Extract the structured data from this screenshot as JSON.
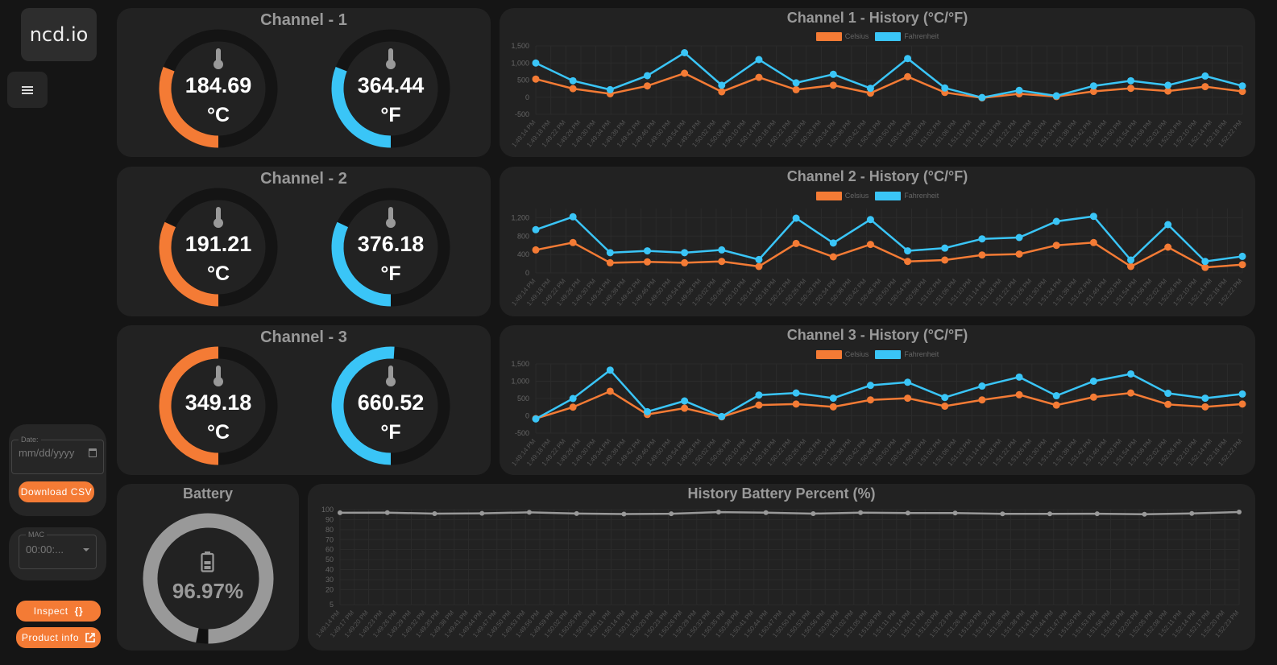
{
  "sidebar": {
    "logo": "ncd.io",
    "menu_icon": "hamburger-menu-icon",
    "date_legend": "Date:",
    "date_placeholder": "mm/dd/yyyy",
    "download_csv": "Download CSV",
    "mac_legend": "MAC",
    "mac_value": "00:00:...",
    "inspect": "Inspect",
    "inspect_icon": "{}",
    "product_info": "Product info"
  },
  "colors": {
    "celsius": "#f47b35",
    "fahrenheit": "#3ac5f7",
    "battery": "#999999",
    "bg": "#151515",
    "panel": "#222222"
  },
  "channels": [
    {
      "title": "Channel - 1",
      "celsius": "184.69",
      "celsius_unit": "°C",
      "fahrenheit": "364.44",
      "fahrenheit_unit": "°F",
      "celsius_fraction": 0.31,
      "fahrenheit_fraction": 0.31
    },
    {
      "title": "Channel - 2",
      "celsius": "191.21",
      "celsius_unit": "°C",
      "fahrenheit": "376.18",
      "fahrenheit_unit": "°F",
      "celsius_fraction": 0.32,
      "fahrenheit_fraction": 0.32
    },
    {
      "title": "Channel - 3",
      "celsius": "349.18",
      "celsius_unit": "°C",
      "fahrenheit": "660.52",
      "fahrenheit_unit": "°F",
      "celsius_fraction": 0.5,
      "fahrenheit_fraction": 0.51
    }
  ],
  "battery": {
    "title": "Battery",
    "value": "96.97%",
    "fraction": 0.9697
  },
  "chart_data": [
    {
      "type": "line",
      "title": "Channel 1 - History (°C/°F)",
      "legend": [
        "Celsius",
        "Fahrenheit"
      ],
      "legend_position": "top",
      "ylim": [
        -500,
        1500
      ],
      "yticks": [
        "1,500",
        "1,000",
        "500",
        "0",
        "-500"
      ],
      "ytick_values": [
        1500,
        1000,
        500,
        0,
        -500
      ],
      "x_labels": [
        "1:49:14 PM",
        "1:49:18 PM",
        "1:49:22 PM",
        "1:49:26 PM",
        "1:49:30 PM",
        "1:49:34 PM",
        "1:49:38 PM",
        "1:49:42 PM",
        "1:49:46 PM",
        "1:49:50 PM",
        "1:49:54 PM",
        "1:49:58 PM",
        "1:50:02 PM",
        "1:50:06 PM",
        "1:50:10 PM",
        "1:50:14 PM",
        "1:50:18 PM",
        "1:50:22 PM",
        "1:50:26 PM",
        "1:50:30 PM",
        "1:50:34 PM",
        "1:50:38 PM",
        "1:50:42 PM",
        "1:50:46 PM",
        "1:50:50 PM",
        "1:50:54 PM",
        "1:50:58 PM",
        "1:51:02 PM",
        "1:51:06 PM",
        "1:51:10 PM",
        "1:51:14 PM",
        "1:51:18 PM",
        "1:51:22 PM",
        "1:51:26 PM",
        "1:51:30 PM",
        "1:51:34 PM",
        "1:51:38 PM",
        "1:51:42 PM",
        "1:51:46 PM",
        "1:51:50 PM",
        "1:51:54 PM",
        "1:51:58 PM",
        "1:52:02 PM",
        "1:52:06 PM",
        "1:52:10 PM",
        "1:52:14 PM",
        "1:52:18 PM",
        "1:52:22 PM"
      ],
      "series": [
        {
          "name": "Celsius",
          "values": [
            530,
            250,
            100,
            330,
            700,
            160,
            580,
            220,
            350,
            120,
            600,
            140,
            -20,
            100,
            20,
            170,
            260,
            180,
            310,
            170
          ]
        },
        {
          "name": "Fahrenheit",
          "values": [
            1000,
            480,
            220,
            630,
            1300,
            350,
            1100,
            420,
            670,
            260,
            1130,
            270,
            -10,
            200,
            40,
            330,
            480,
            350,
            620,
            330
          ]
        }
      ]
    },
    {
      "type": "line",
      "title": "Channel 2 - History (°C/°F)",
      "legend": [
        "Celsius",
        "Fahrenheit"
      ],
      "legend_position": "top",
      "ylim": [
        0,
        1400
      ],
      "yticks": [
        "1,200",
        "800",
        "400",
        "0"
      ],
      "ytick_values": [
        1200,
        800,
        400,
        0
      ],
      "x_labels": [
        "1:49:14 PM",
        "1:49:18 PM",
        "1:49:22 PM",
        "1:49:26 PM",
        "1:49:30 PM",
        "1:49:34 PM",
        "1:49:38 PM",
        "1:49:42 PM",
        "1:49:46 PM",
        "1:49:50 PM",
        "1:49:54 PM",
        "1:49:58 PM",
        "1:50:02 PM",
        "1:50:06 PM",
        "1:50:10 PM",
        "1:50:14 PM",
        "1:50:18 PM",
        "1:50:22 PM",
        "1:50:26 PM",
        "1:50:30 PM",
        "1:50:34 PM",
        "1:50:38 PM",
        "1:50:42 PM",
        "1:50:46 PM",
        "1:50:50 PM",
        "1:50:54 PM",
        "1:50:58 PM",
        "1:51:02 PM",
        "1:51:06 PM",
        "1:51:10 PM",
        "1:51:14 PM",
        "1:51:18 PM",
        "1:51:22 PM",
        "1:51:26 PM",
        "1:51:30 PM",
        "1:51:34 PM",
        "1:51:38 PM",
        "1:51:42 PM",
        "1:51:46 PM",
        "1:51:50 PM",
        "1:51:54 PM",
        "1:51:58 PM",
        "1:52:02 PM",
        "1:52:06 PM",
        "1:52:10 PM",
        "1:52:14 PM",
        "1:52:18 PM",
        "1:52:22 PM"
      ],
      "series": [
        {
          "name": "Celsius",
          "values": [
            500,
            660,
            220,
            240,
            220,
            250,
            140,
            640,
            350,
            620,
            250,
            280,
            390,
            410,
            600,
            660,
            140,
            560,
            120,
            180
          ]
        },
        {
          "name": "Fahrenheit",
          "values": [
            940,
            1220,
            440,
            480,
            440,
            500,
            290,
            1190,
            650,
            1160,
            480,
            540,
            740,
            770,
            1120,
            1230,
            280,
            1050,
            250,
            360
          ]
        }
      ]
    },
    {
      "type": "line",
      "title": "Channel 3 - History (°C/°F)",
      "legend": [
        "Celsius",
        "Fahrenheit"
      ],
      "legend_position": "top",
      "ylim": [
        -500,
        1500
      ],
      "yticks": [
        "1,500",
        "1,000",
        "500",
        "0",
        "-500"
      ],
      "ytick_values": [
        1500,
        1000,
        500,
        0,
        -500
      ],
      "x_labels": [
        "1:49:14 PM",
        "1:49:18 PM",
        "1:49:22 PM",
        "1:49:26 PM",
        "1:49:30 PM",
        "1:49:34 PM",
        "1:49:38 PM",
        "1:49:42 PM",
        "1:49:46 PM",
        "1:49:50 PM",
        "1:49:54 PM",
        "1:49:58 PM",
        "1:50:02 PM",
        "1:50:06 PM",
        "1:50:10 PM",
        "1:50:14 PM",
        "1:50:18 PM",
        "1:50:22 PM",
        "1:50:26 PM",
        "1:50:30 PM",
        "1:50:34 PM",
        "1:50:38 PM",
        "1:50:42 PM",
        "1:50:46 PM",
        "1:50:50 PM",
        "1:50:54 PM",
        "1:50:58 PM",
        "1:51:02 PM",
        "1:51:06 PM",
        "1:51:10 PM",
        "1:51:14 PM",
        "1:51:18 PM",
        "1:51:22 PM",
        "1:51:26 PM",
        "1:51:30 PM",
        "1:51:34 PM",
        "1:51:38 PM",
        "1:51:42 PM",
        "1:51:46 PM",
        "1:51:50 PM",
        "1:51:54 PM",
        "1:51:58 PM",
        "1:52:02 PM",
        "1:52:06 PM",
        "1:52:10 PM",
        "1:52:14 PM",
        "1:52:18 PM",
        "1:52:22 PM"
      ],
      "series": [
        {
          "name": "Celsius",
          "values": [
            -80,
            250,
            710,
            40,
            220,
            -30,
            310,
            340,
            260,
            460,
            510,
            280,
            460,
            610,
            310,
            540,
            660,
            330,
            260,
            340
          ]
        },
        {
          "name": "Fahrenheit",
          "values": [
            -90,
            500,
            1320,
            120,
            430,
            -20,
            600,
            660,
            510,
            880,
            970,
            530,
            860,
            1120,
            580,
            1000,
            1210,
            650,
            510,
            630
          ]
        }
      ]
    },
    {
      "type": "line",
      "title": "History Battery Percent (%)",
      "legend": [],
      "ylim": [
        5,
        100
      ],
      "yticks": [
        "100",
        "90",
        "80",
        "70",
        "60",
        "50",
        "40",
        "30",
        "20",
        "5"
      ],
      "ytick_values": [
        100,
        90,
        80,
        70,
        60,
        50,
        40,
        30,
        20,
        5
      ],
      "x_labels": [
        "1:49:14 PM",
        "1:49:17 PM",
        "1:49:20 PM",
        "1:49:23 PM",
        "1:49:26 PM",
        "1:49:29 PM",
        "1:49:32 PM",
        "1:49:35 PM",
        "1:49:38 PM",
        "1:49:41 PM",
        "1:49:44 PM",
        "1:49:47 PM",
        "1:49:50 PM",
        "1:49:53 PM",
        "1:49:56 PM",
        "1:49:59 PM",
        "1:50:02 PM",
        "1:50:05 PM",
        "1:50:08 PM",
        "1:50:11 PM",
        "1:50:14 PM",
        "1:50:17 PM",
        "1:50:20 PM",
        "1:50:23 PM",
        "1:50:26 PM",
        "1:50:29 PM",
        "1:50:32 PM",
        "1:50:35 PM",
        "1:50:38 PM",
        "1:50:41 PM",
        "1:50:44 PM",
        "1:50:47 PM",
        "1:50:50 PM",
        "1:50:53 PM",
        "1:50:56 PM",
        "1:50:59 PM",
        "1:51:02 PM",
        "1:51:05 PM",
        "1:51:08 PM",
        "1:51:11 PM",
        "1:51:14 PM",
        "1:51:17 PM",
        "1:51:20 PM",
        "1:51:23 PM",
        "1:51:26 PM",
        "1:51:29 PM",
        "1:51:32 PM",
        "1:51:35 PM",
        "1:51:38 PM",
        "1:51:41 PM",
        "1:51:44 PM",
        "1:51:47 PM",
        "1:51:50 PM",
        "1:51:53 PM",
        "1:51:56 PM",
        "1:51:59 PM",
        "1:52:02 PM",
        "1:52:05 PM",
        "1:52:08 PM",
        "1:52:11 PM",
        "1:52:14 PM",
        "1:52:17 PM",
        "1:52:20 PM",
        "1:52:23 PM"
      ],
      "series": [
        {
          "name": "Battery",
          "values": [
            96.9,
            97.0,
            96.0,
            96.3,
            97.3,
            96.1,
            95.6,
            95.9,
            97.5,
            97.0,
            96.0,
            97.0,
            96.6,
            96.6,
            95.8,
            95.8,
            95.9,
            95.4,
            96.2,
            97.6
          ]
        }
      ]
    }
  ]
}
